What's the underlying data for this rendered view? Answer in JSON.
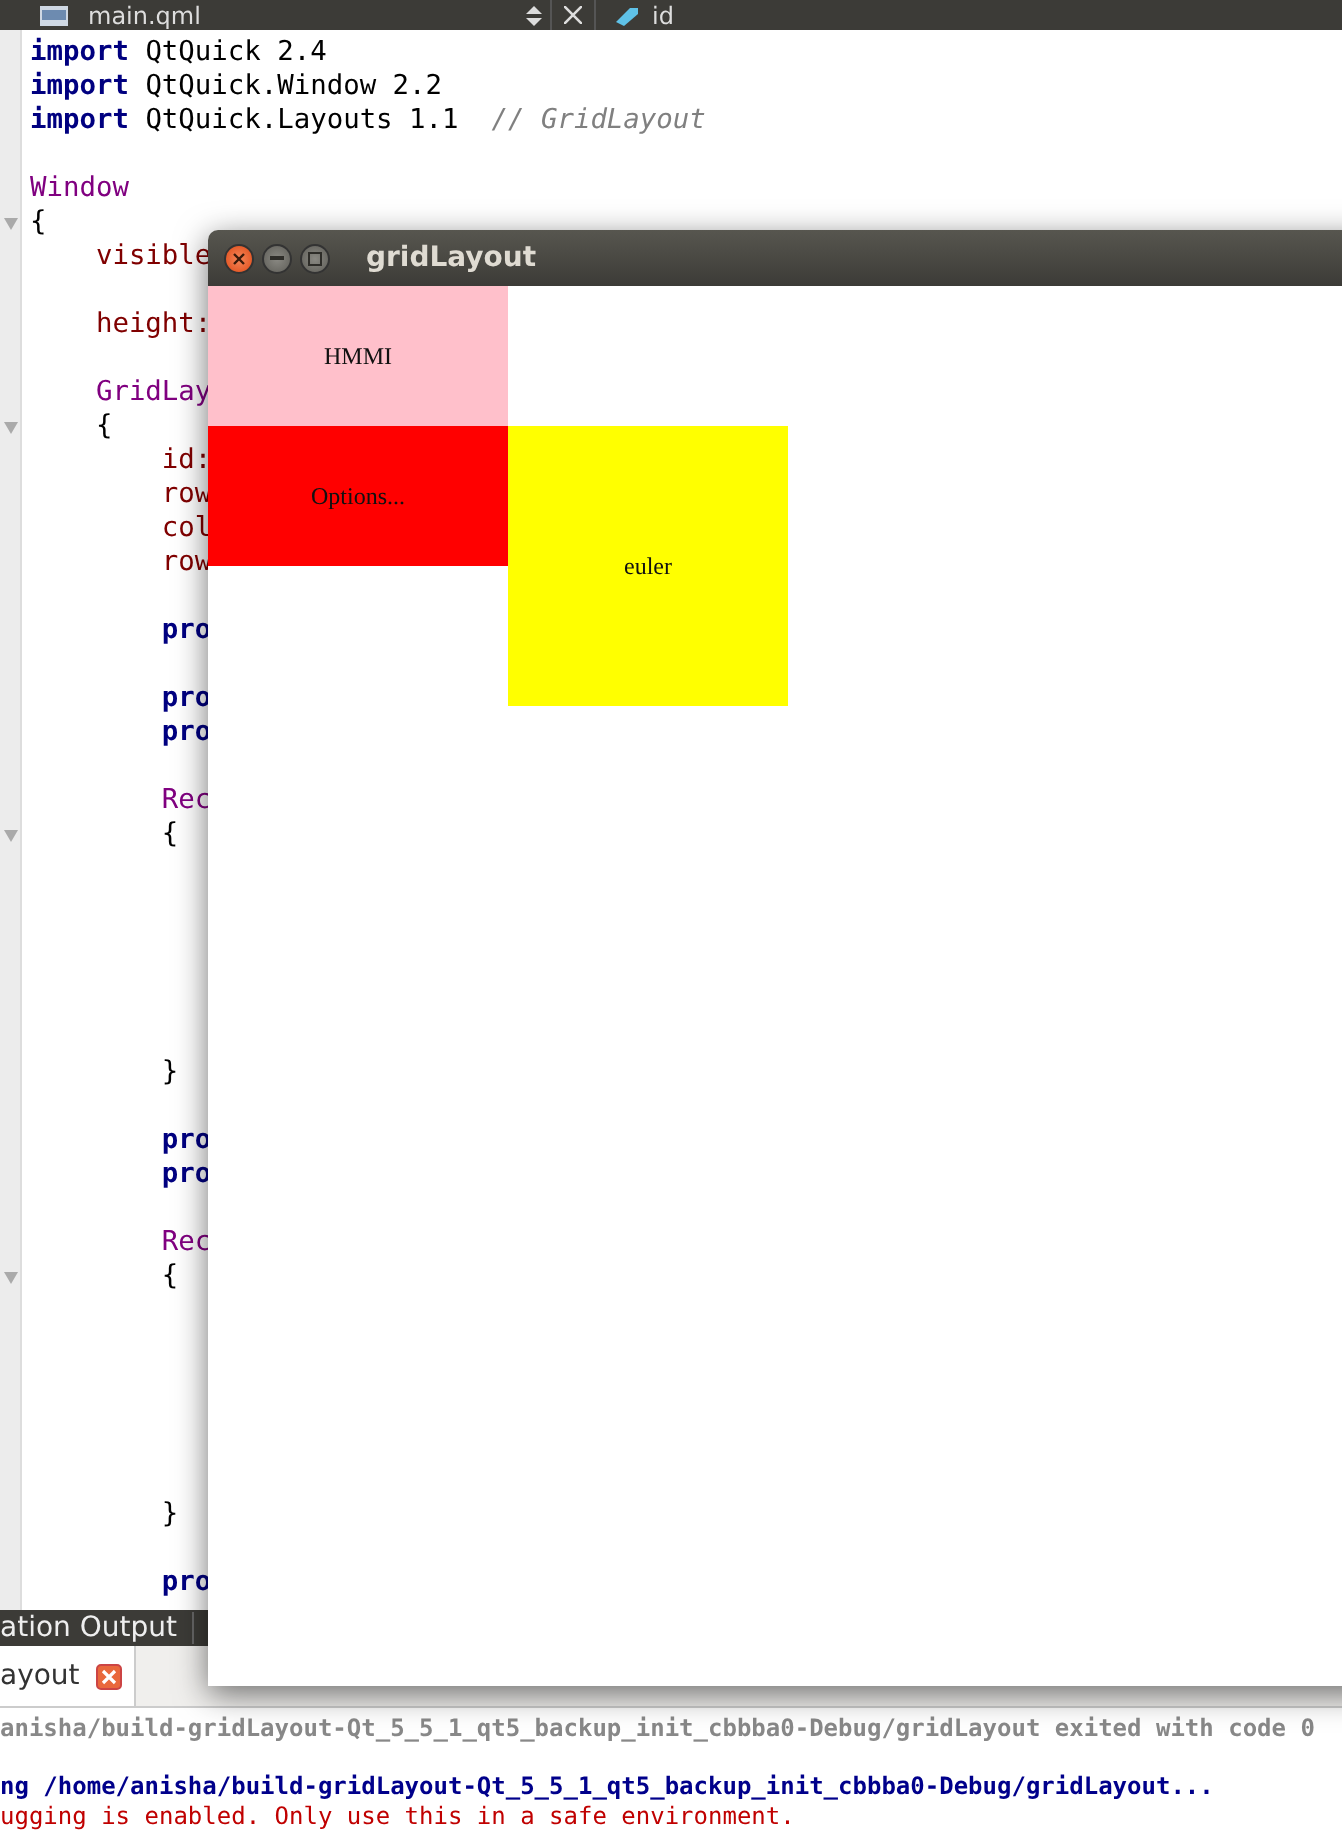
{
  "editor_tabs": {
    "file": {
      "label": "main.qml"
    },
    "symbol": {
      "label": "id"
    }
  },
  "code": [
    {
      "kind": "code",
      "tokens": [
        {
          "kind": "keyword",
          "text": "import"
        },
        {
          "kind": "plain",
          "text": " QtQuick 2.4"
        }
      ]
    },
    {
      "kind": "code",
      "tokens": [
        {
          "kind": "keyword",
          "text": "import"
        },
        {
          "kind": "plain",
          "text": " QtQuick.Window 2.2"
        }
      ]
    },
    {
      "kind": "code",
      "tokens": [
        {
          "kind": "keyword",
          "text": "import"
        },
        {
          "kind": "plain",
          "text": " QtQuick.Layouts 1.1  "
        },
        {
          "kind": "comment",
          "text": "// GridLayout"
        }
      ]
    },
    {
      "kind": "blank"
    },
    {
      "kind": "code",
      "tokens": [
        {
          "kind": "type",
          "text": "Window"
        }
      ]
    },
    {
      "kind": "code",
      "fold": true,
      "tokens": [
        {
          "kind": "plain",
          "text": "{"
        }
      ]
    },
    {
      "kind": "code",
      "tokens": [
        {
          "kind": "property",
          "text": "    visible"
        }
      ]
    },
    {
      "kind": "blank"
    },
    {
      "kind": "code",
      "tokens": [
        {
          "kind": "property",
          "text": "    height:"
        }
      ]
    },
    {
      "kind": "blank"
    },
    {
      "kind": "code",
      "tokens": [
        {
          "kind": "type",
          "text": "    GridLay"
        }
      ]
    },
    {
      "kind": "code",
      "fold": true,
      "tokens": [
        {
          "kind": "plain",
          "text": "    {"
        }
      ]
    },
    {
      "kind": "code",
      "tokens": [
        {
          "kind": "property",
          "text": "        id:"
        }
      ]
    },
    {
      "kind": "code",
      "tokens": [
        {
          "kind": "property",
          "text": "        row"
        }
      ]
    },
    {
      "kind": "code",
      "tokens": [
        {
          "kind": "property",
          "text": "        col"
        }
      ]
    },
    {
      "kind": "code",
      "tokens": [
        {
          "kind": "property",
          "text": "        row"
        }
      ]
    },
    {
      "kind": "blank"
    },
    {
      "kind": "code",
      "tokens": [
        {
          "kind": "keyword",
          "text": "        pro"
        }
      ]
    },
    {
      "kind": "blank"
    },
    {
      "kind": "code",
      "tokens": [
        {
          "kind": "keyword",
          "text": "        pro"
        }
      ]
    },
    {
      "kind": "code",
      "tokens": [
        {
          "kind": "keyword",
          "text": "        pro"
        }
      ]
    },
    {
      "kind": "blank"
    },
    {
      "kind": "code",
      "tokens": [
        {
          "kind": "type",
          "text": "        Rec"
        }
      ]
    },
    {
      "kind": "code",
      "fold": true,
      "tokens": [
        {
          "kind": "plain",
          "text": "        {"
        }
      ]
    },
    {
      "kind": "blank"
    },
    {
      "kind": "blank"
    },
    {
      "kind": "blank"
    },
    {
      "kind": "blank"
    },
    {
      "kind": "blank"
    },
    {
      "kind": "blank"
    },
    {
      "kind": "code",
      "tokens": [
        {
          "kind": "plain",
          "text": "        }"
        }
      ]
    },
    {
      "kind": "blank"
    },
    {
      "kind": "code",
      "tokens": [
        {
          "kind": "keyword",
          "text": "        pro"
        }
      ]
    },
    {
      "kind": "code",
      "tokens": [
        {
          "kind": "keyword",
          "text": "        pro"
        }
      ]
    },
    {
      "kind": "blank"
    },
    {
      "kind": "code",
      "tokens": [
        {
          "kind": "type",
          "text": "        Rec"
        }
      ]
    },
    {
      "kind": "code",
      "fold": true,
      "tokens": [
        {
          "kind": "plain",
          "text": "        {"
        }
      ]
    },
    {
      "kind": "blank"
    },
    {
      "kind": "blank"
    },
    {
      "kind": "blank"
    },
    {
      "kind": "blank"
    },
    {
      "kind": "blank"
    },
    {
      "kind": "blank"
    },
    {
      "kind": "code",
      "tokens": [
        {
          "kind": "plain",
          "text": "        }"
        }
      ]
    },
    {
      "kind": "blank"
    },
    {
      "kind": "code",
      "tokens": [
        {
          "kind": "keyword",
          "text": "        pro"
        }
      ]
    }
  ],
  "output_pane": {
    "title": "ation Output",
    "tab": {
      "label": "ayout"
    },
    "lines": [
      {
        "kind": "info",
        "text": "anisha/build-gridLayout-Qt_5_5_1_qt5_backup_init_cbbba0-Debug/gridLayout exited with code 0"
      },
      {
        "kind": "blank"
      },
      {
        "kind": "start",
        "text": "ng /home/anisha/build-gridLayout-Qt_5_5_1_qt5_backup_init_cbbba0-Debug/gridLayout..."
      },
      {
        "kind": "error",
        "text": "ugging is enabled. Only use this in a safe environment."
      }
    ]
  },
  "app_window": {
    "title": "gridLayout",
    "cells": [
      {
        "label": "HMMI",
        "color": "#ffc0cb"
      },
      {
        "label": "Options...",
        "color": "#ff0000"
      },
      {
        "label": "euler",
        "color": "#ffff00"
      }
    ]
  }
}
